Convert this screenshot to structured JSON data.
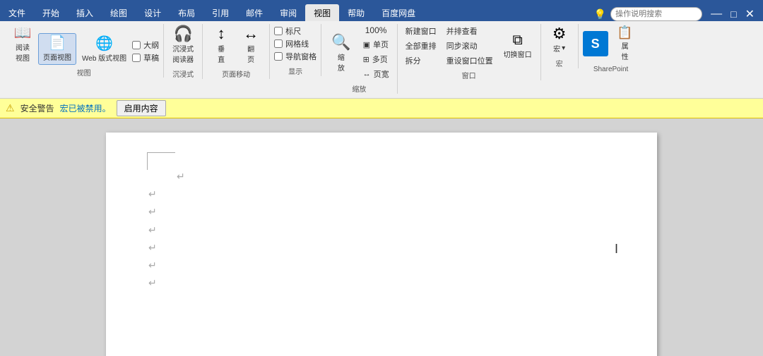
{
  "tabs": [
    {
      "label": "文件",
      "active": false
    },
    {
      "label": "开始",
      "active": false
    },
    {
      "label": "插入",
      "active": false
    },
    {
      "label": "绘图",
      "active": false
    },
    {
      "label": "设计",
      "active": false
    },
    {
      "label": "布局",
      "active": false
    },
    {
      "label": "引用",
      "active": false
    },
    {
      "label": "邮件",
      "active": false
    },
    {
      "label": "审阅",
      "active": false
    },
    {
      "label": "视图",
      "active": true
    },
    {
      "label": "帮助",
      "active": false
    },
    {
      "label": "百度网盘",
      "active": false
    }
  ],
  "help_search": "操作说明搜索",
  "ribbon": {
    "groups": [
      {
        "id": "views",
        "label": "视图",
        "buttons": [
          {
            "id": "read-view",
            "icon": "📖",
            "label": "阅读\n视图"
          },
          {
            "id": "page-view",
            "icon": "📄",
            "label": "页面视图"
          },
          {
            "id": "web-view",
            "icon": "🌐",
            "label": "Web 版式视图"
          }
        ],
        "checkboxes": [
          {
            "id": "outline",
            "label": "大纲",
            "checked": false
          },
          {
            "id": "draft",
            "label": "草稿",
            "checked": false
          }
        ]
      },
      {
        "id": "immersive",
        "label": "沉浸式",
        "buttons": [
          {
            "id": "immersive-reader",
            "icon": "👁",
            "label": "沉浸式\n阅读器"
          }
        ]
      },
      {
        "id": "page-move",
        "label": "页面移动",
        "buttons": [
          {
            "id": "vertical",
            "icon": "↕",
            "label": "垂\n直"
          },
          {
            "id": "flip",
            "icon": "↔",
            "label": "翻\n页"
          }
        ]
      },
      {
        "id": "display",
        "label": "显示",
        "checkboxes": [
          {
            "id": "ruler",
            "label": "标尺",
            "checked": false
          },
          {
            "id": "gridlines",
            "label": "网格线",
            "checked": false
          },
          {
            "id": "nav-pane",
            "label": "导航窗格",
            "checked": false
          }
        ]
      },
      {
        "id": "zoom",
        "label": "缩放",
        "zoom_icon": "🔍",
        "zoom_label": "缩\n放",
        "zoom_pct": "100%",
        "btn_single": "单页",
        "btn_multi": "多页",
        "btn_width": "页宽"
      },
      {
        "id": "window",
        "label": "窗口",
        "btns": [
          {
            "id": "new-window",
            "label": "新建窗口"
          },
          {
            "id": "all-arrange",
            "label": "全部重排"
          },
          {
            "id": "split",
            "label": "拆分"
          }
        ],
        "stacked": [
          {
            "id": "side-by-side",
            "label": "并排查看"
          },
          {
            "id": "sync-scroll",
            "label": "同步滚动"
          },
          {
            "id": "reset-position",
            "label": "重设窗口位置"
          }
        ],
        "switch_btn": "切换窗口"
      },
      {
        "id": "macros",
        "label": "宏",
        "btn": "宏",
        "has_dropdown": true
      },
      {
        "id": "sharepoint",
        "label": "SharePoint",
        "icon": "S",
        "btn": "属\n性"
      }
    ]
  },
  "security_bar": {
    "icon": "⚠",
    "text": "安全警告",
    "link": "宏已被禁用。",
    "enable_btn": "启用内容"
  },
  "document": {
    "cursor_char": "I",
    "paragraph_marks": [
      "↵",
      "↵",
      "↵",
      "↵",
      "↵",
      "↵"
    ],
    "indent_mark": "↵"
  }
}
